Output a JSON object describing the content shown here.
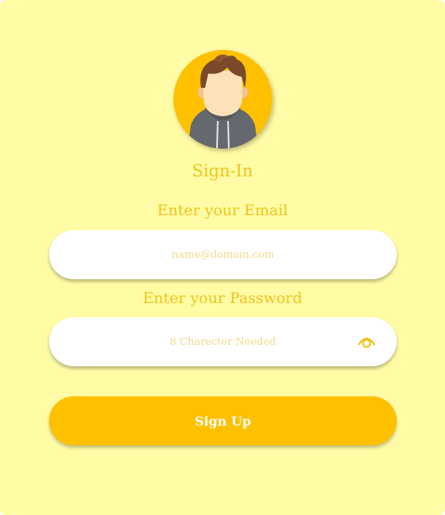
{
  "form": {
    "title": "Sign-In",
    "email_label": "Enter your Email",
    "email_placeholder": "name@domain.com",
    "password_label": "Enter your Password",
    "password_placeholder": "8 Charecter Needed",
    "submit_label": "Sign Up"
  },
  "icons": {
    "avatar": "user-avatar-icon",
    "toggle_password": "eye-icon"
  },
  "colors": {
    "card_background": "#fffca5",
    "accent": "#ffc000",
    "label_text": "#f2c21b",
    "placeholder_text": "#f3d98a",
    "field_background": "#ffffff"
  }
}
